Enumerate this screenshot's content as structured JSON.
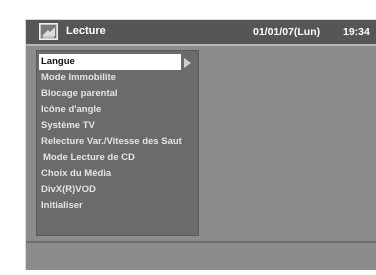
{
  "header": {
    "title": "Lecture",
    "title_icon": "play-icon",
    "date": "01/01/07(Lun)",
    "time": "19:34"
  },
  "menu": {
    "selected_index": 0,
    "items": [
      {
        "label": "Langue"
      },
      {
        "label": "Mode Immobilite"
      },
      {
        "label": "Blocage parental"
      },
      {
        "label": "Icône d'angle"
      },
      {
        "label": "Système TV"
      },
      {
        "label": "Relecture Var./Vitesse des Saut"
      },
      {
        "label": "Mode Lecture de CD"
      },
      {
        "label": "Choix du Média"
      },
      {
        "label": "DivX(R)VOD"
      },
      {
        "label": "Initialiser"
      }
    ]
  },
  "colors": {
    "panel": "#8c8c8c",
    "titlebar": "#565656",
    "menu_bg": "#6b6b6b",
    "highlight": "#ffffff",
    "text": "#e4e4e4"
  }
}
